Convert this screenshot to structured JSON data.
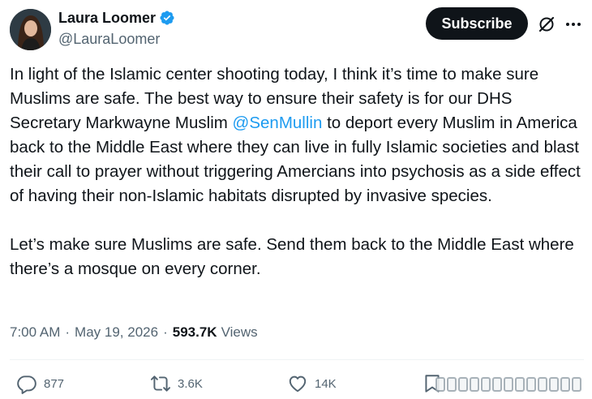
{
  "author": {
    "display_name": "Laura Loomer",
    "handle": "@LauraLoomer",
    "verified": true
  },
  "header": {
    "subscribe_label": "Subscribe",
    "grok_icon": "grok-icon",
    "more_icon": "more-icon"
  },
  "tweet": {
    "paragraph1_part1": "In light of the Islamic center shooting today, I think it’s time to make sure Muslims are safe. The best way to ensure their safety is for our DHS Secretary Markwayne Muslim ",
    "mention": "@SenMullin",
    "paragraph1_part2": " to deport every Muslim in America back to the Middle East where they can live in fully Islamic societies and blast their call to prayer without triggering Amercians into psychosis as a side effect of having their non-Islamic habitats disrupted by invasive species.",
    "paragraph2": "Let’s make sure Muslims are safe. Send them back to the Middle East where there’s a mosque on every corner."
  },
  "meta": {
    "time": "7:00 AM",
    "separator": "·",
    "date": "May 19, 2026",
    "views_count": "593.7K",
    "views_label": "Views"
  },
  "actions": {
    "replies": "877",
    "reposts": "3.6K",
    "likes": "14K"
  },
  "colors": {
    "accent": "#1d9bf0",
    "text": "#0f1419",
    "secondary": "#536471",
    "button_bg": "#0f1419"
  }
}
